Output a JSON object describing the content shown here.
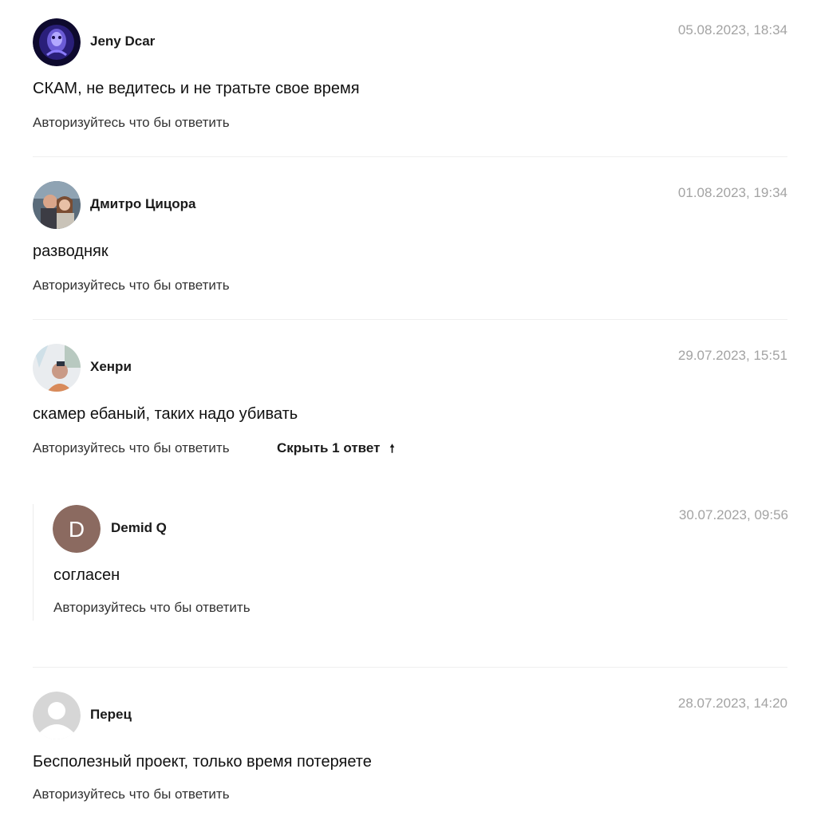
{
  "comments": [
    {
      "author": "Jeny Dcar",
      "date": "05.08.2023, 18:34",
      "text": "СКАМ, не ведитесь и не тратьте свое время",
      "reply_link": "Авторизуйтесь что бы ответить"
    },
    {
      "author": "Дмитро Цицора",
      "date": "01.08.2023, 19:34",
      "text": "разводняк",
      "reply_link": "Авторизуйтесь что бы ответить"
    },
    {
      "author": "Хенри",
      "date": "29.07.2023, 15:51",
      "text": "скамер ебаный, таких надо убивать",
      "reply_link": "Авторизуйтесь что бы ответить",
      "toggle_replies": "Скрыть 1 ответ",
      "toggle_icon": "arrow-up-icon",
      "replies": [
        {
          "author": "Demid Q",
          "avatar_letter": "D",
          "avatar_color": "#8b6a60",
          "date": "30.07.2023, 09:56",
          "text": "согласен",
          "reply_link": "Авторизуйтесь что бы ответить"
        }
      ]
    },
    {
      "author": "Перец",
      "date": "28.07.2023, 14:20",
      "text": "Бесполезный проект, только время потеряете",
      "reply_link": "Авторизуйтесь что бы ответить"
    }
  ]
}
